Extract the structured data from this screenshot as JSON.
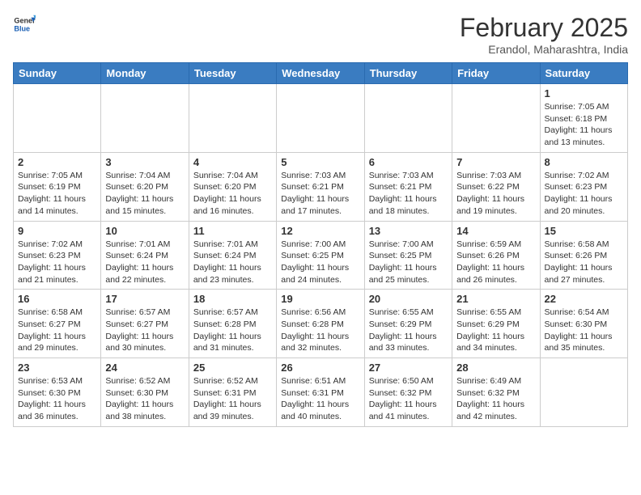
{
  "header": {
    "logo_general": "General",
    "logo_blue": "Blue",
    "month_year": "February 2025",
    "location": "Erandol, Maharashtra, India"
  },
  "weekdays": [
    "Sunday",
    "Monday",
    "Tuesday",
    "Wednesday",
    "Thursday",
    "Friday",
    "Saturday"
  ],
  "weeks": [
    [
      {
        "day": "",
        "sunrise": "",
        "sunset": "",
        "daylight": ""
      },
      {
        "day": "",
        "sunrise": "",
        "sunset": "",
        "daylight": ""
      },
      {
        "day": "",
        "sunrise": "",
        "sunset": "",
        "daylight": ""
      },
      {
        "day": "",
        "sunrise": "",
        "sunset": "",
        "daylight": ""
      },
      {
        "day": "",
        "sunrise": "",
        "sunset": "",
        "daylight": ""
      },
      {
        "day": "",
        "sunrise": "",
        "sunset": "",
        "daylight": ""
      },
      {
        "day": "1",
        "sunrise": "Sunrise: 7:05 AM",
        "sunset": "Sunset: 6:18 PM",
        "daylight": "Daylight: 11 hours and 13 minutes."
      }
    ],
    [
      {
        "day": "2",
        "sunrise": "Sunrise: 7:05 AM",
        "sunset": "Sunset: 6:19 PM",
        "daylight": "Daylight: 11 hours and 14 minutes."
      },
      {
        "day": "3",
        "sunrise": "Sunrise: 7:04 AM",
        "sunset": "Sunset: 6:20 PM",
        "daylight": "Daylight: 11 hours and 15 minutes."
      },
      {
        "day": "4",
        "sunrise": "Sunrise: 7:04 AM",
        "sunset": "Sunset: 6:20 PM",
        "daylight": "Daylight: 11 hours and 16 minutes."
      },
      {
        "day": "5",
        "sunrise": "Sunrise: 7:03 AM",
        "sunset": "Sunset: 6:21 PM",
        "daylight": "Daylight: 11 hours and 17 minutes."
      },
      {
        "day": "6",
        "sunrise": "Sunrise: 7:03 AM",
        "sunset": "Sunset: 6:21 PM",
        "daylight": "Daylight: 11 hours and 18 minutes."
      },
      {
        "day": "7",
        "sunrise": "Sunrise: 7:03 AM",
        "sunset": "Sunset: 6:22 PM",
        "daylight": "Daylight: 11 hours and 19 minutes."
      },
      {
        "day": "8",
        "sunrise": "Sunrise: 7:02 AM",
        "sunset": "Sunset: 6:23 PM",
        "daylight": "Daylight: 11 hours and 20 minutes."
      }
    ],
    [
      {
        "day": "9",
        "sunrise": "Sunrise: 7:02 AM",
        "sunset": "Sunset: 6:23 PM",
        "daylight": "Daylight: 11 hours and 21 minutes."
      },
      {
        "day": "10",
        "sunrise": "Sunrise: 7:01 AM",
        "sunset": "Sunset: 6:24 PM",
        "daylight": "Daylight: 11 hours and 22 minutes."
      },
      {
        "day": "11",
        "sunrise": "Sunrise: 7:01 AM",
        "sunset": "Sunset: 6:24 PM",
        "daylight": "Daylight: 11 hours and 23 minutes."
      },
      {
        "day": "12",
        "sunrise": "Sunrise: 7:00 AM",
        "sunset": "Sunset: 6:25 PM",
        "daylight": "Daylight: 11 hours and 24 minutes."
      },
      {
        "day": "13",
        "sunrise": "Sunrise: 7:00 AM",
        "sunset": "Sunset: 6:25 PM",
        "daylight": "Daylight: 11 hours and 25 minutes."
      },
      {
        "day": "14",
        "sunrise": "Sunrise: 6:59 AM",
        "sunset": "Sunset: 6:26 PM",
        "daylight": "Daylight: 11 hours and 26 minutes."
      },
      {
        "day": "15",
        "sunrise": "Sunrise: 6:58 AM",
        "sunset": "Sunset: 6:26 PM",
        "daylight": "Daylight: 11 hours and 27 minutes."
      }
    ],
    [
      {
        "day": "16",
        "sunrise": "Sunrise: 6:58 AM",
        "sunset": "Sunset: 6:27 PM",
        "daylight": "Daylight: 11 hours and 29 minutes."
      },
      {
        "day": "17",
        "sunrise": "Sunrise: 6:57 AM",
        "sunset": "Sunset: 6:27 PM",
        "daylight": "Daylight: 11 hours and 30 minutes."
      },
      {
        "day": "18",
        "sunrise": "Sunrise: 6:57 AM",
        "sunset": "Sunset: 6:28 PM",
        "daylight": "Daylight: 11 hours and 31 minutes."
      },
      {
        "day": "19",
        "sunrise": "Sunrise: 6:56 AM",
        "sunset": "Sunset: 6:28 PM",
        "daylight": "Daylight: 11 hours and 32 minutes."
      },
      {
        "day": "20",
        "sunrise": "Sunrise: 6:55 AM",
        "sunset": "Sunset: 6:29 PM",
        "daylight": "Daylight: 11 hours and 33 minutes."
      },
      {
        "day": "21",
        "sunrise": "Sunrise: 6:55 AM",
        "sunset": "Sunset: 6:29 PM",
        "daylight": "Daylight: 11 hours and 34 minutes."
      },
      {
        "day": "22",
        "sunrise": "Sunrise: 6:54 AM",
        "sunset": "Sunset: 6:30 PM",
        "daylight": "Daylight: 11 hours and 35 minutes."
      }
    ],
    [
      {
        "day": "23",
        "sunrise": "Sunrise: 6:53 AM",
        "sunset": "Sunset: 6:30 PM",
        "daylight": "Daylight: 11 hours and 36 minutes."
      },
      {
        "day": "24",
        "sunrise": "Sunrise: 6:52 AM",
        "sunset": "Sunset: 6:30 PM",
        "daylight": "Daylight: 11 hours and 38 minutes."
      },
      {
        "day": "25",
        "sunrise": "Sunrise: 6:52 AM",
        "sunset": "Sunset: 6:31 PM",
        "daylight": "Daylight: 11 hours and 39 minutes."
      },
      {
        "day": "26",
        "sunrise": "Sunrise: 6:51 AM",
        "sunset": "Sunset: 6:31 PM",
        "daylight": "Daylight: 11 hours and 40 minutes."
      },
      {
        "day": "27",
        "sunrise": "Sunrise: 6:50 AM",
        "sunset": "Sunset: 6:32 PM",
        "daylight": "Daylight: 11 hours and 41 minutes."
      },
      {
        "day": "28",
        "sunrise": "Sunrise: 6:49 AM",
        "sunset": "Sunset: 6:32 PM",
        "daylight": "Daylight: 11 hours and 42 minutes."
      },
      {
        "day": "",
        "sunrise": "",
        "sunset": "",
        "daylight": ""
      }
    ]
  ]
}
